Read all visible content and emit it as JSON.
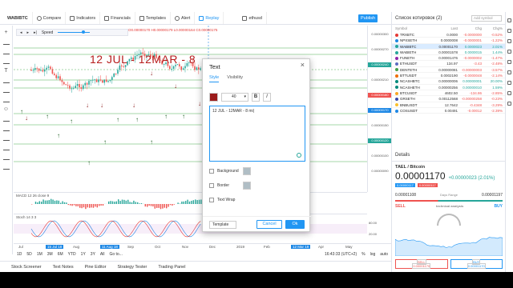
{
  "topbar": {
    "compare": "Compare",
    "indicators": "Indicators",
    "financials": "Financials",
    "templates": "Templates",
    "alert": "Alert",
    "replay": "Replay",
    "layout": "ethusd",
    "publish": "Publish"
  },
  "symbol": "WABIBTC",
  "ohlc_text": "O0.00000170 H0.00000179 L0.00000164 C0.00000175",
  "playback": {
    "speed_label": "Speed"
  },
  "chart_text": "12 JUL - 12MAR - 8",
  "price_axis": {
    "labels": [
      "0.00000300",
      "0.00000270",
      "0.00000240",
      "0.00000210",
      "0.00000180",
      "0.00000170",
      "0.00000150",
      "0.00000120",
      "0.00000100",
      "0.00000090"
    ]
  },
  "panes": {
    "macd_label": "MACD 12 26 close 9",
    "stoch_label": "Stoch 14 3 3",
    "stoch_axis": [
      "80.00",
      "20.00"
    ]
  },
  "time_axis": {
    "labels": [
      "Jul",
      "15 Jul 18",
      "Aug",
      "11 Aug 18",
      "Sep",
      "Oct",
      "Nov",
      "Dec",
      "2019",
      "Feb",
      "12 Mar 19",
      "Apr",
      "May"
    ]
  },
  "range_bar": {
    "ranges": [
      "1D",
      "5D",
      "1M",
      "3M",
      "6M",
      "YTD",
      "1Y",
      "3Y",
      "All"
    ],
    "goto": "Go to...",
    "clock": "16:43:33 (UTC+2)",
    "right_opts": [
      "%",
      "log",
      "auto"
    ]
  },
  "bottom_tabs": [
    "Stock Screener",
    "Text Notes",
    "Pine Editor",
    "Strategy Tester",
    "Trading Panel"
  ],
  "watchlist": {
    "title": "Список котировок (2)",
    "add_placeholder": "Add symbol",
    "columns": [
      "Symbol",
      "Last",
      "Chg",
      "Chg%"
    ],
    "rows": [
      {
        "sym": "TRXBTC",
        "last": "0.0000",
        "chg": "-0.0000000",
        "pct": "-0.52%",
        "dir": "neg",
        "color": "#e53935"
      },
      {
        "sym": "NPXSETH",
        "last": "0.0000008",
        "chg": "-0.0000001",
        "pct": "-1.22%",
        "dir": "neg",
        "color": "#1e88e5"
      },
      {
        "sym": "WABIBTC",
        "last": "0.00001170",
        "chg": "0.0000023",
        "pct": "2.01%",
        "dir": "pos",
        "color": "#26a69a"
      },
      {
        "sym": "WABIETH",
        "last": "0.00001578",
        "chg": "0.0000015",
        "pct": "1.44%",
        "dir": "pos",
        "color": "#26a69a"
      },
      {
        "sym": "FUNETH",
        "last": "0.00001476",
        "chg": "-0.0000002",
        "pct": "-1.47%",
        "dir": "neg",
        "color": "#8e24aa"
      },
      {
        "sym": "ETHUSDT",
        "last": "134.97",
        "chg": "-3.43",
        "pct": "-2.48%",
        "dir": "neg",
        "color": "#5c6bc0"
      },
      {
        "sym": "DENTETH",
        "last": "0.00000081",
        "chg": "-0.00000003",
        "pct": "-3.57%",
        "dir": "neg",
        "color": "#43a047"
      },
      {
        "sym": "BTTUSDT",
        "last": "0.0002190",
        "chg": "-0.0000048",
        "pct": "-2.14%",
        "dir": "neg",
        "color": "#ef6c00"
      },
      {
        "sym": "NCASHBTC",
        "last": "0.00000006",
        "chg": "0.00000001",
        "pct": "20.00%",
        "dir": "pos",
        "color": "#00897b"
      },
      {
        "sym": "NCASHETH",
        "last": "0.00000256",
        "chg": "0.00000010",
        "pct": "1.59%",
        "dir": "pos",
        "color": "#00897b"
      },
      {
        "sym": "BTCUSDT",
        "last": "4602.50",
        "chg": "-134.86",
        "pct": "-2.85%",
        "dir": "neg",
        "color": "#f9a825"
      },
      {
        "sym": "GRSETH",
        "last": "0.00112568",
        "chg": "-0.00000258",
        "pct": "-0.23%",
        "dir": "neg",
        "color": "#3949ab"
      },
      {
        "sym": "BNBUSDT",
        "last": "12.7642",
        "chg": "-0.4348",
        "pct": "-3.29%",
        "dir": "neg",
        "color": "#fbc02d"
      },
      {
        "sym": "COSUSDT",
        "last": "0.00491",
        "chg": "-0.00012",
        "pct": "-2.39%",
        "dir": "neg",
        "color": "#1e88e5"
      }
    ]
  },
  "details": {
    "header": "Details",
    "name": "TAEL / Bitcoin",
    "price": "0.00001170",
    "change": "+0.00000023 (2.01%)",
    "tag1": "0.00000117",
    "tag2": "0.00000117",
    "low": "0.00001108",
    "high": "0.00001197",
    "range_label": "Days Range",
    "sell": "SELL",
    "buy": "BUY",
    "tech": "technical analysis"
  },
  "mini": {
    "sell": "SELL",
    "buy": "BUY",
    "sell_price": "0.00001170",
    "buy_price": "0.00001170"
  },
  "modal": {
    "title": "Text",
    "tab_style": "Style",
    "tab_visibility": "Visibility",
    "font_size": "40",
    "bold": "B",
    "italic": "I",
    "text_value": "12 JUL - 12MAR - 8 mi|",
    "background": "Background",
    "border": "Border",
    "text_wrap": "Text Wrap",
    "template": "Template",
    "cancel": "Cancel",
    "ok": "Ok"
  },
  "colors": {
    "accent": "#2196f3",
    "text_color": "#9b1c1c",
    "up": "#26a69a",
    "down": "#ef5350"
  }
}
